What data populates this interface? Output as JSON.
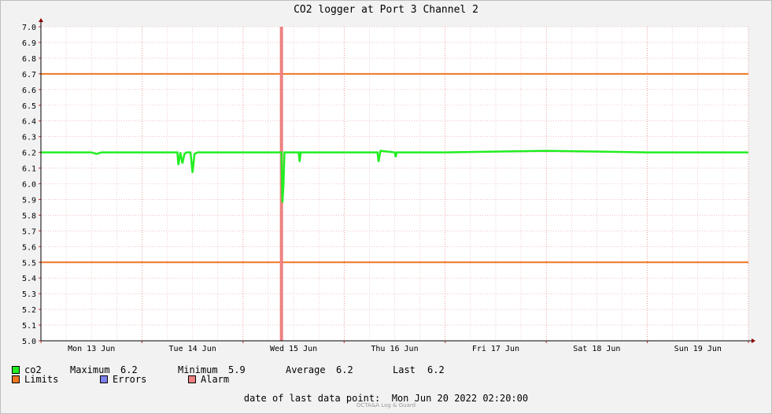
{
  "chart_data": {
    "type": "line",
    "title": "CO2 logger at Port 3 Channel 2",
    "xlabel": "",
    "ylabel": "",
    "ylim": [
      5.0,
      7.0
    ],
    "yticks": [
      "5.0",
      "5.1",
      "5.2",
      "5.3",
      "5.4",
      "5.5",
      "5.6",
      "5.7",
      "5.8",
      "5.9",
      "6.0",
      "6.1",
      "6.2",
      "6.3",
      "6.4",
      "6.5",
      "6.6",
      "6.7",
      "6.8",
      "6.9",
      "7.0"
    ],
    "xlim": [
      0,
      7
    ],
    "xtick_labels": [
      "Mon 13 Jun",
      "Tue 14 Jun",
      "Wed 15 Jun",
      "Thu 16 Jun",
      "Fri 17 Jun",
      "Sat 18 Jun",
      "Sun 19 Jun"
    ],
    "grid": true,
    "series": [
      {
        "name": "co2",
        "color": "#22ee22",
        "baseline": 6.2,
        "points": [
          [
            0.0,
            6.2
          ],
          [
            0.5,
            6.2
          ],
          [
            0.55,
            6.19
          ],
          [
            0.6,
            6.2
          ],
          [
            1.0,
            6.2
          ],
          [
            1.35,
            6.2
          ],
          [
            1.36,
            6.12
          ],
          [
            1.38,
            6.2
          ],
          [
            1.4,
            6.13
          ],
          [
            1.42,
            6.19
          ],
          [
            1.44,
            6.2
          ],
          [
            1.48,
            6.2
          ],
          [
            1.5,
            6.07
          ],
          [
            1.52,
            6.19
          ],
          [
            1.55,
            6.2
          ],
          [
            2.0,
            6.2
          ],
          [
            2.38,
            6.2
          ],
          [
            2.39,
            5.88
          ],
          [
            2.4,
            5.99
          ],
          [
            2.41,
            6.2
          ],
          [
            2.55,
            6.2
          ],
          [
            2.56,
            6.14
          ],
          [
            2.57,
            6.2
          ],
          [
            3.0,
            6.2
          ],
          [
            3.33,
            6.2
          ],
          [
            3.34,
            6.14
          ],
          [
            3.36,
            6.21
          ],
          [
            3.5,
            6.2
          ],
          [
            3.51,
            6.17
          ],
          [
            3.52,
            6.2
          ],
          [
            4.0,
            6.2
          ],
          [
            5.0,
            6.21
          ],
          [
            6.0,
            6.2
          ],
          [
            6.8,
            6.2
          ],
          [
            7.0,
            6.2
          ]
        ]
      },
      {
        "name": "Limits",
        "color": "#ee7722",
        "values": [
          6.7,
          5.5
        ]
      },
      {
        "name": "Alarm",
        "color": "#ee8080",
        "x": 2.38
      }
    ]
  },
  "legend": {
    "co2": {
      "label": "co2",
      "color": "#22ee22"
    },
    "stats": {
      "max_label": "Maximum",
      "max_value": "6.2",
      "min_label": "Minimum",
      "min_value": "5.9",
      "avg_label": "Average",
      "avg_value": "6.2",
      "last_label": "Last",
      "last_value": "6.2"
    },
    "limits": {
      "label": "Limits",
      "color": "#ee7722"
    },
    "errors": {
      "label": "Errors",
      "color": "#8080ee"
    },
    "alarm": {
      "label": "Alarm",
      "color": "#ee8080"
    }
  },
  "footer": {
    "date_label": "date of last data point:",
    "date_value": "Mon Jun 20 2022 02:20:00",
    "brand": "OCTA&A Log & Guard"
  }
}
